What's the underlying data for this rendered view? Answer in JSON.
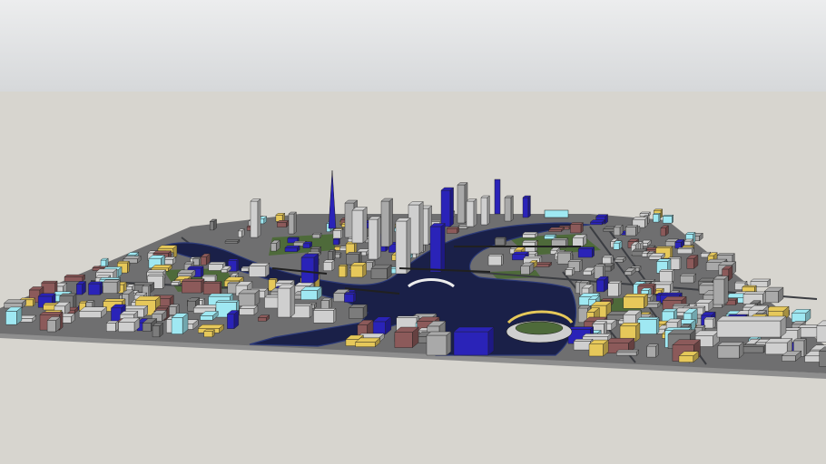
{
  "scene": {
    "description_name": "3d-city-model-render",
    "colors": {
      "sky_top": "#ECEDEE",
      "sky_bottom": "#D6D8DA",
      "ground": "#D7D5CF",
      "base": "#8E8E8E",
      "water": "#1A2048",
      "water_edge": "#2C3A78",
      "park": "#4E6A3A",
      "road": "#3B3D42",
      "building_light": "#CFCFCF",
      "building_mid": "#A9A9A9",
      "building_dark": "#7C7C7C",
      "accent_blue": "#2A23B8",
      "accent_cyan": "#9FE8F2",
      "accent_yellow": "#E6C85A",
      "accent_brick": "#8C5A5A",
      "outline": "#1E1E1E"
    }
  }
}
